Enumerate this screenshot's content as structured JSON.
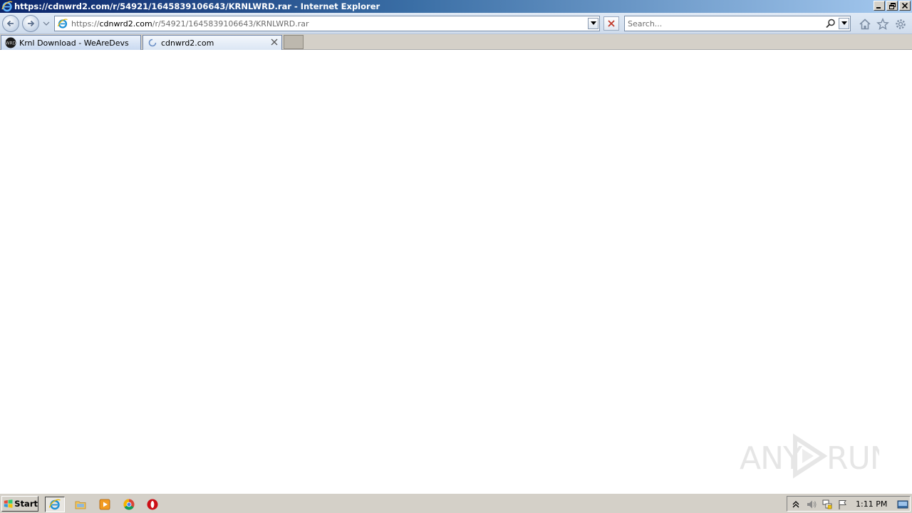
{
  "window": {
    "title": "https://cdnwrd2.com/r/54921/1645839106643/KRNLWRD.rar - Internet Explorer",
    "minimize_icon": "minimize-icon",
    "restore_icon": "restore-icon",
    "close_icon": "close-icon"
  },
  "navbar": {
    "address": {
      "prefix": "https://",
      "host": "cdnwrd2.com",
      "path": "/r/54921/1645839106643/KRNLWRD.rar"
    },
    "search": {
      "placeholder": "Search..."
    }
  },
  "tabs": [
    {
      "label": "Krnl Download - WeAreDevs",
      "icon": "wearedevs-favicon",
      "active": false
    },
    {
      "label": "cdnwrd2.com",
      "icon": "loading-spinner-icon",
      "active": true
    }
  ],
  "watermark": {
    "text": "ANY RUN"
  },
  "taskbar": {
    "start_label": "Start",
    "clock": "1:11 PM"
  },
  "colors": {
    "titlebar_start": "#0a246a",
    "titlebar_end": "#a6caf0",
    "taskbar": "#d4d0c8",
    "stop_red": "#c0392b"
  }
}
